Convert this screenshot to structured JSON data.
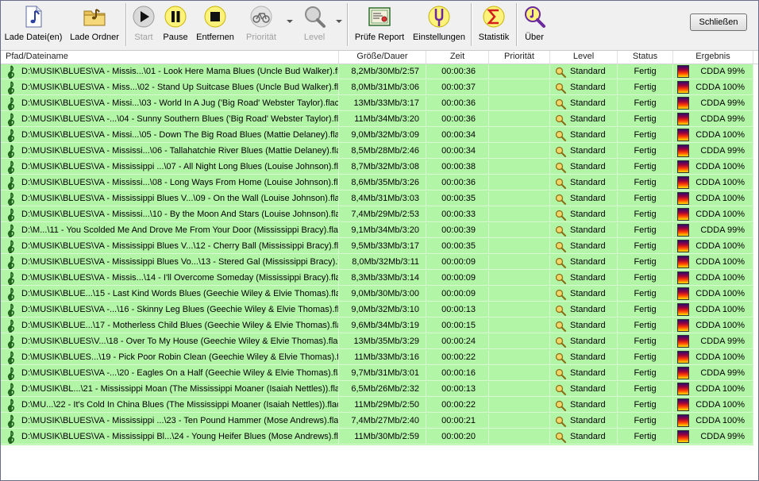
{
  "toolbar": {
    "load_files": "Lade Datei(en)",
    "load_folder": "Lade Ordner",
    "start": "Start",
    "pause": "Pause",
    "remove": "Entfernen",
    "priority": "Priorität",
    "level": "Level",
    "check_report": "Prüfe Report",
    "settings": "Einstellungen",
    "statistics": "Statistik",
    "about": "Über",
    "close": "Schließen"
  },
  "columns": {
    "path": "Pfad/Dateiname",
    "size": "Größe/Dauer",
    "time": "Zeit",
    "priority": "Priorität",
    "level": "Level",
    "status": "Status",
    "result": "Ergebnis"
  },
  "rows": [
    {
      "path": "D:\\MUSIK\\BLUES\\VA - Missis...\\01 - Look Here Mama Blues (Uncle Bud Walker).flac",
      "size": "8,2Mb/30Mb/2:57",
      "time": "00:00:36",
      "priority": "",
      "level": "Standard",
      "status": "Fertig",
      "result": "CDDA 99%"
    },
    {
      "path": "D:\\MUSIK\\BLUES\\VA - Miss...\\02 - Stand Up Suitcase Blues (Uncle Bud Walker).flac",
      "size": "8,0Mb/31Mb/3:06",
      "time": "00:00:37",
      "priority": "",
      "level": "Standard",
      "status": "Fertig",
      "result": "CDDA 100%"
    },
    {
      "path": "D:\\MUSIK\\BLUES\\VA - Missi...\\03 - World In A Jug ('Big Road' Webster Taylor).flac",
      "size": "13Mb/33Mb/3:17",
      "time": "00:00:36",
      "priority": "",
      "level": "Standard",
      "status": "Fertig",
      "result": "CDDA 99%"
    },
    {
      "path": "D:\\MUSIK\\BLUES\\VA -...\\04 - Sunny Southern Blues ('Big Road' Webster Taylor).flac",
      "size": "11Mb/34Mb/3:20",
      "time": "00:00:36",
      "priority": "",
      "level": "Standard",
      "status": "Fertig",
      "result": "CDDA 99%"
    },
    {
      "path": "D:\\MUSIK\\BLUES\\VA - Missi...\\05 - Down The Big Road Blues (Mattie Delaney).flac",
      "size": "9,0Mb/32Mb/3:09",
      "time": "00:00:34",
      "priority": "",
      "level": "Standard",
      "status": "Fertig",
      "result": "CDDA 100%"
    },
    {
      "path": "D:\\MUSIK\\BLUES\\VA - Mississi...\\06 - Tallahatchie River Blues (Mattie Delaney).flac",
      "size": "8,5Mb/28Mb/2:46",
      "time": "00:00:34",
      "priority": "",
      "level": "Standard",
      "status": "Fertig",
      "result": "CDDA 99%"
    },
    {
      "path": "D:\\MUSIK\\BLUES\\VA - Mississippi ...\\07 - All Night Long Blues (Louise Johnson).flac",
      "size": "8,7Mb/32Mb/3:08",
      "time": "00:00:38",
      "priority": "",
      "level": "Standard",
      "status": "Fertig",
      "result": "CDDA 100%"
    },
    {
      "path": "D:\\MUSIK\\BLUES\\VA - Mississi...\\08 - Long Ways From Home (Louise Johnson).flac",
      "size": "8,6Mb/35Mb/3:26",
      "time": "00:00:36",
      "priority": "",
      "level": "Standard",
      "status": "Fertig",
      "result": "CDDA 100%"
    },
    {
      "path": "D:\\MUSIK\\BLUES\\VA - Mississippi Blues V...\\09 - On the Wall (Louise Johnson).flac",
      "size": "8,4Mb/31Mb/3:03",
      "time": "00:00:35",
      "priority": "",
      "level": "Standard",
      "status": "Fertig",
      "result": "CDDA 100%"
    },
    {
      "path": "D:\\MUSIK\\BLUES\\VA - Mississi...\\10 - By the Moon And Stars (Louise Johnson).flac",
      "size": "7,4Mb/29Mb/2:53",
      "time": "00:00:33",
      "priority": "",
      "level": "Standard",
      "status": "Fertig",
      "result": "CDDA 100%"
    },
    {
      "path": "D:\\M...\\11 - You Scolded Me And Drove Me From Your Door (Mississippi Bracy).flac",
      "size": "9,1Mb/34Mb/3:20",
      "time": "00:00:39",
      "priority": "",
      "level": "Standard",
      "status": "Fertig",
      "result": "CDDA 99%"
    },
    {
      "path": "D:\\MUSIK\\BLUES\\VA - Mississippi Blues V...\\12 - Cherry Ball (Mississippi Bracy).flac",
      "size": "9,5Mb/33Mb/3:17",
      "time": "00:00:35",
      "priority": "",
      "level": "Standard",
      "status": "Fertig",
      "result": "CDDA 100%"
    },
    {
      "path": "D:\\MUSIK\\BLUES\\VA - Mississippi Blues Vo...\\13 - Stered Gal (Mississippi Bracy).flac",
      "size": "8,0Mb/32Mb/3:11",
      "time": "00:00:09",
      "priority": "",
      "level": "Standard",
      "status": "Fertig",
      "result": "CDDA 100%"
    },
    {
      "path": "D:\\MUSIK\\BLUES\\VA - Missis...\\14 - I'll Overcome Someday (Mississippi Bracy).flac",
      "size": "8,3Mb/33Mb/3:14",
      "time": "00:00:09",
      "priority": "",
      "level": "Standard",
      "status": "Fertig",
      "result": "CDDA 100%"
    },
    {
      "path": "D:\\MUSIK\\BLUE...\\15 - Last Kind Words Blues (Geechie Wiley & Elvie Thomas).flac",
      "size": "9,0Mb/30Mb/3:00",
      "time": "00:00:09",
      "priority": "",
      "level": "Standard",
      "status": "Fertig",
      "result": "CDDA 100%"
    },
    {
      "path": "D:\\MUSIK\\BLUES\\VA -...\\16 - Skinny Leg Blues (Geechie Wiley & Elvie Thomas).flac",
      "size": "9,0Mb/32Mb/3:10",
      "time": "00:00:13",
      "priority": "",
      "level": "Standard",
      "status": "Fertig",
      "result": "CDDA 100%"
    },
    {
      "path": "D:\\MUSIK\\BLUE...\\17 - Motherless Child Blues (Geechie Wiley & Elvie Thomas).flac",
      "size": "9,6Mb/34Mb/3:19",
      "time": "00:00:15",
      "priority": "",
      "level": "Standard",
      "status": "Fertig",
      "result": "CDDA 100%"
    },
    {
      "path": "D:\\MUSIK\\BLUES\\V...\\18 - Over To My House (Geechie Wiley & Elvie Thomas).flac",
      "size": "13Mb/35Mb/3:29",
      "time": "00:00:24",
      "priority": "",
      "level": "Standard",
      "status": "Fertig",
      "result": "CDDA 99%"
    },
    {
      "path": "D:\\MUSIK\\BLUES...\\19 - Pick Poor Robin Clean (Geechie Wiley & Elvie Thomas).flac",
      "size": "11Mb/33Mb/3:16",
      "time": "00:00:22",
      "priority": "",
      "level": "Standard",
      "status": "Fertig",
      "result": "CDDA 100%"
    },
    {
      "path": "D:\\MUSIK\\BLUES\\VA -...\\20 - Eagles On a Half (Geechie Wiley & Elvie Thomas).flac",
      "size": "9,7Mb/31Mb/3:01",
      "time": "00:00:16",
      "priority": "",
      "level": "Standard",
      "status": "Fertig",
      "result": "CDDA 99%"
    },
    {
      "path": "D:\\MUSIK\\BL...\\21 - Mississippi Moan (The Mississippi Moaner (Isaiah Nettles)).flac",
      "size": "6,5Mb/26Mb/2:32",
      "time": "00:00:13",
      "priority": "",
      "level": "Standard",
      "status": "Fertig",
      "result": "CDDA 100%"
    },
    {
      "path": "D:\\MU...\\22 - It's Cold In China Blues (The Mississippi Moaner (Isaiah Nettles)).flac",
      "size": "11Mb/29Mb/2:50",
      "time": "00:00:22",
      "priority": "",
      "level": "Standard",
      "status": "Fertig",
      "result": "CDDA 100%"
    },
    {
      "path": "D:\\MUSIK\\BLUES\\VA - Mississippi ...\\23 - Ten Pound Hammer (Mose Andrews).flac",
      "size": "7,4Mb/27Mb/2:40",
      "time": "00:00:21",
      "priority": "",
      "level": "Standard",
      "status": "Fertig",
      "result": "CDDA 100%"
    },
    {
      "path": "D:\\MUSIK\\BLUES\\VA - Mississippi Bl...\\24 - Young Heifer Blues (Mose Andrews).flac",
      "size": "11Mb/30Mb/2:59",
      "time": "00:00:20",
      "priority": "",
      "level": "Standard",
      "status": "Fertig",
      "result": "CDDA 99%"
    }
  ]
}
